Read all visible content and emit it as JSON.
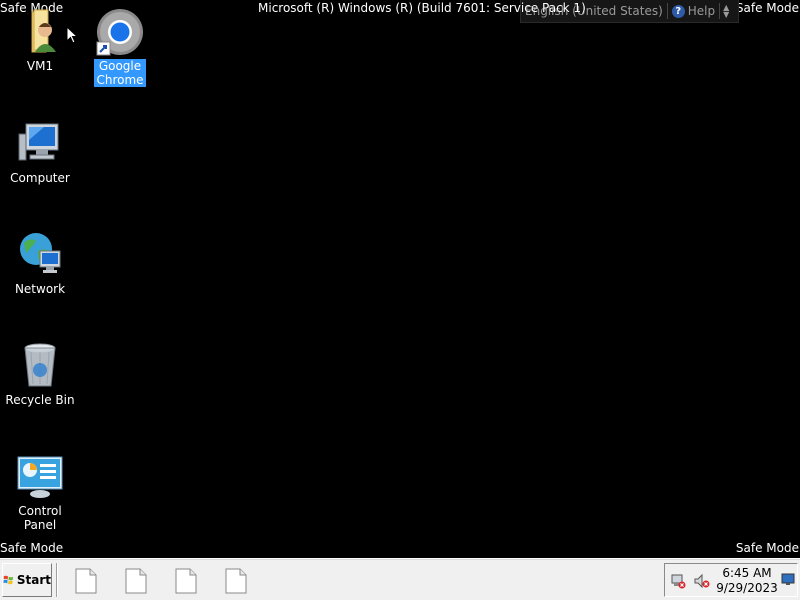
{
  "screen": {
    "safe_mode_label": "Safe Mode",
    "build_text": "Microsoft (R) Windows (R) (Build 7601: Service Pack 1)"
  },
  "language_bar": {
    "language": "English (United States)",
    "help_label": "Help",
    "help_glyph": "?"
  },
  "desktop_icons": [
    {
      "label": "VM1",
      "icon": "user-folder-icon",
      "selected": false
    },
    {
      "label": "Google Chrome",
      "label_line1": "Google",
      "label_line2": "Chrome",
      "icon": "chrome-icon",
      "selected": true
    },
    {
      "label": "Computer",
      "icon": "computer-icon",
      "selected": false
    },
    {
      "label": "Network",
      "icon": "network-icon",
      "selected": false
    },
    {
      "label": "Recycle Bin",
      "icon": "recycle-bin-icon",
      "selected": false
    },
    {
      "label": "Control Panel",
      "icon": "control-panel-icon",
      "selected": false
    }
  ],
  "taskbar": {
    "start_label": "Start",
    "items": [
      {
        "icon": "document-icon"
      },
      {
        "icon": "document-icon"
      },
      {
        "icon": "document-icon"
      },
      {
        "icon": "document-icon"
      }
    ],
    "tray": {
      "icons": [
        "network-disconnected-icon",
        "volume-muted-icon"
      ],
      "time": "6:45 AM",
      "date": "9/29/2023"
    }
  },
  "colors": {
    "desktop_bg": "#000000",
    "selection": "#3399ff",
    "taskbar_bg": "#f0f0f0"
  }
}
